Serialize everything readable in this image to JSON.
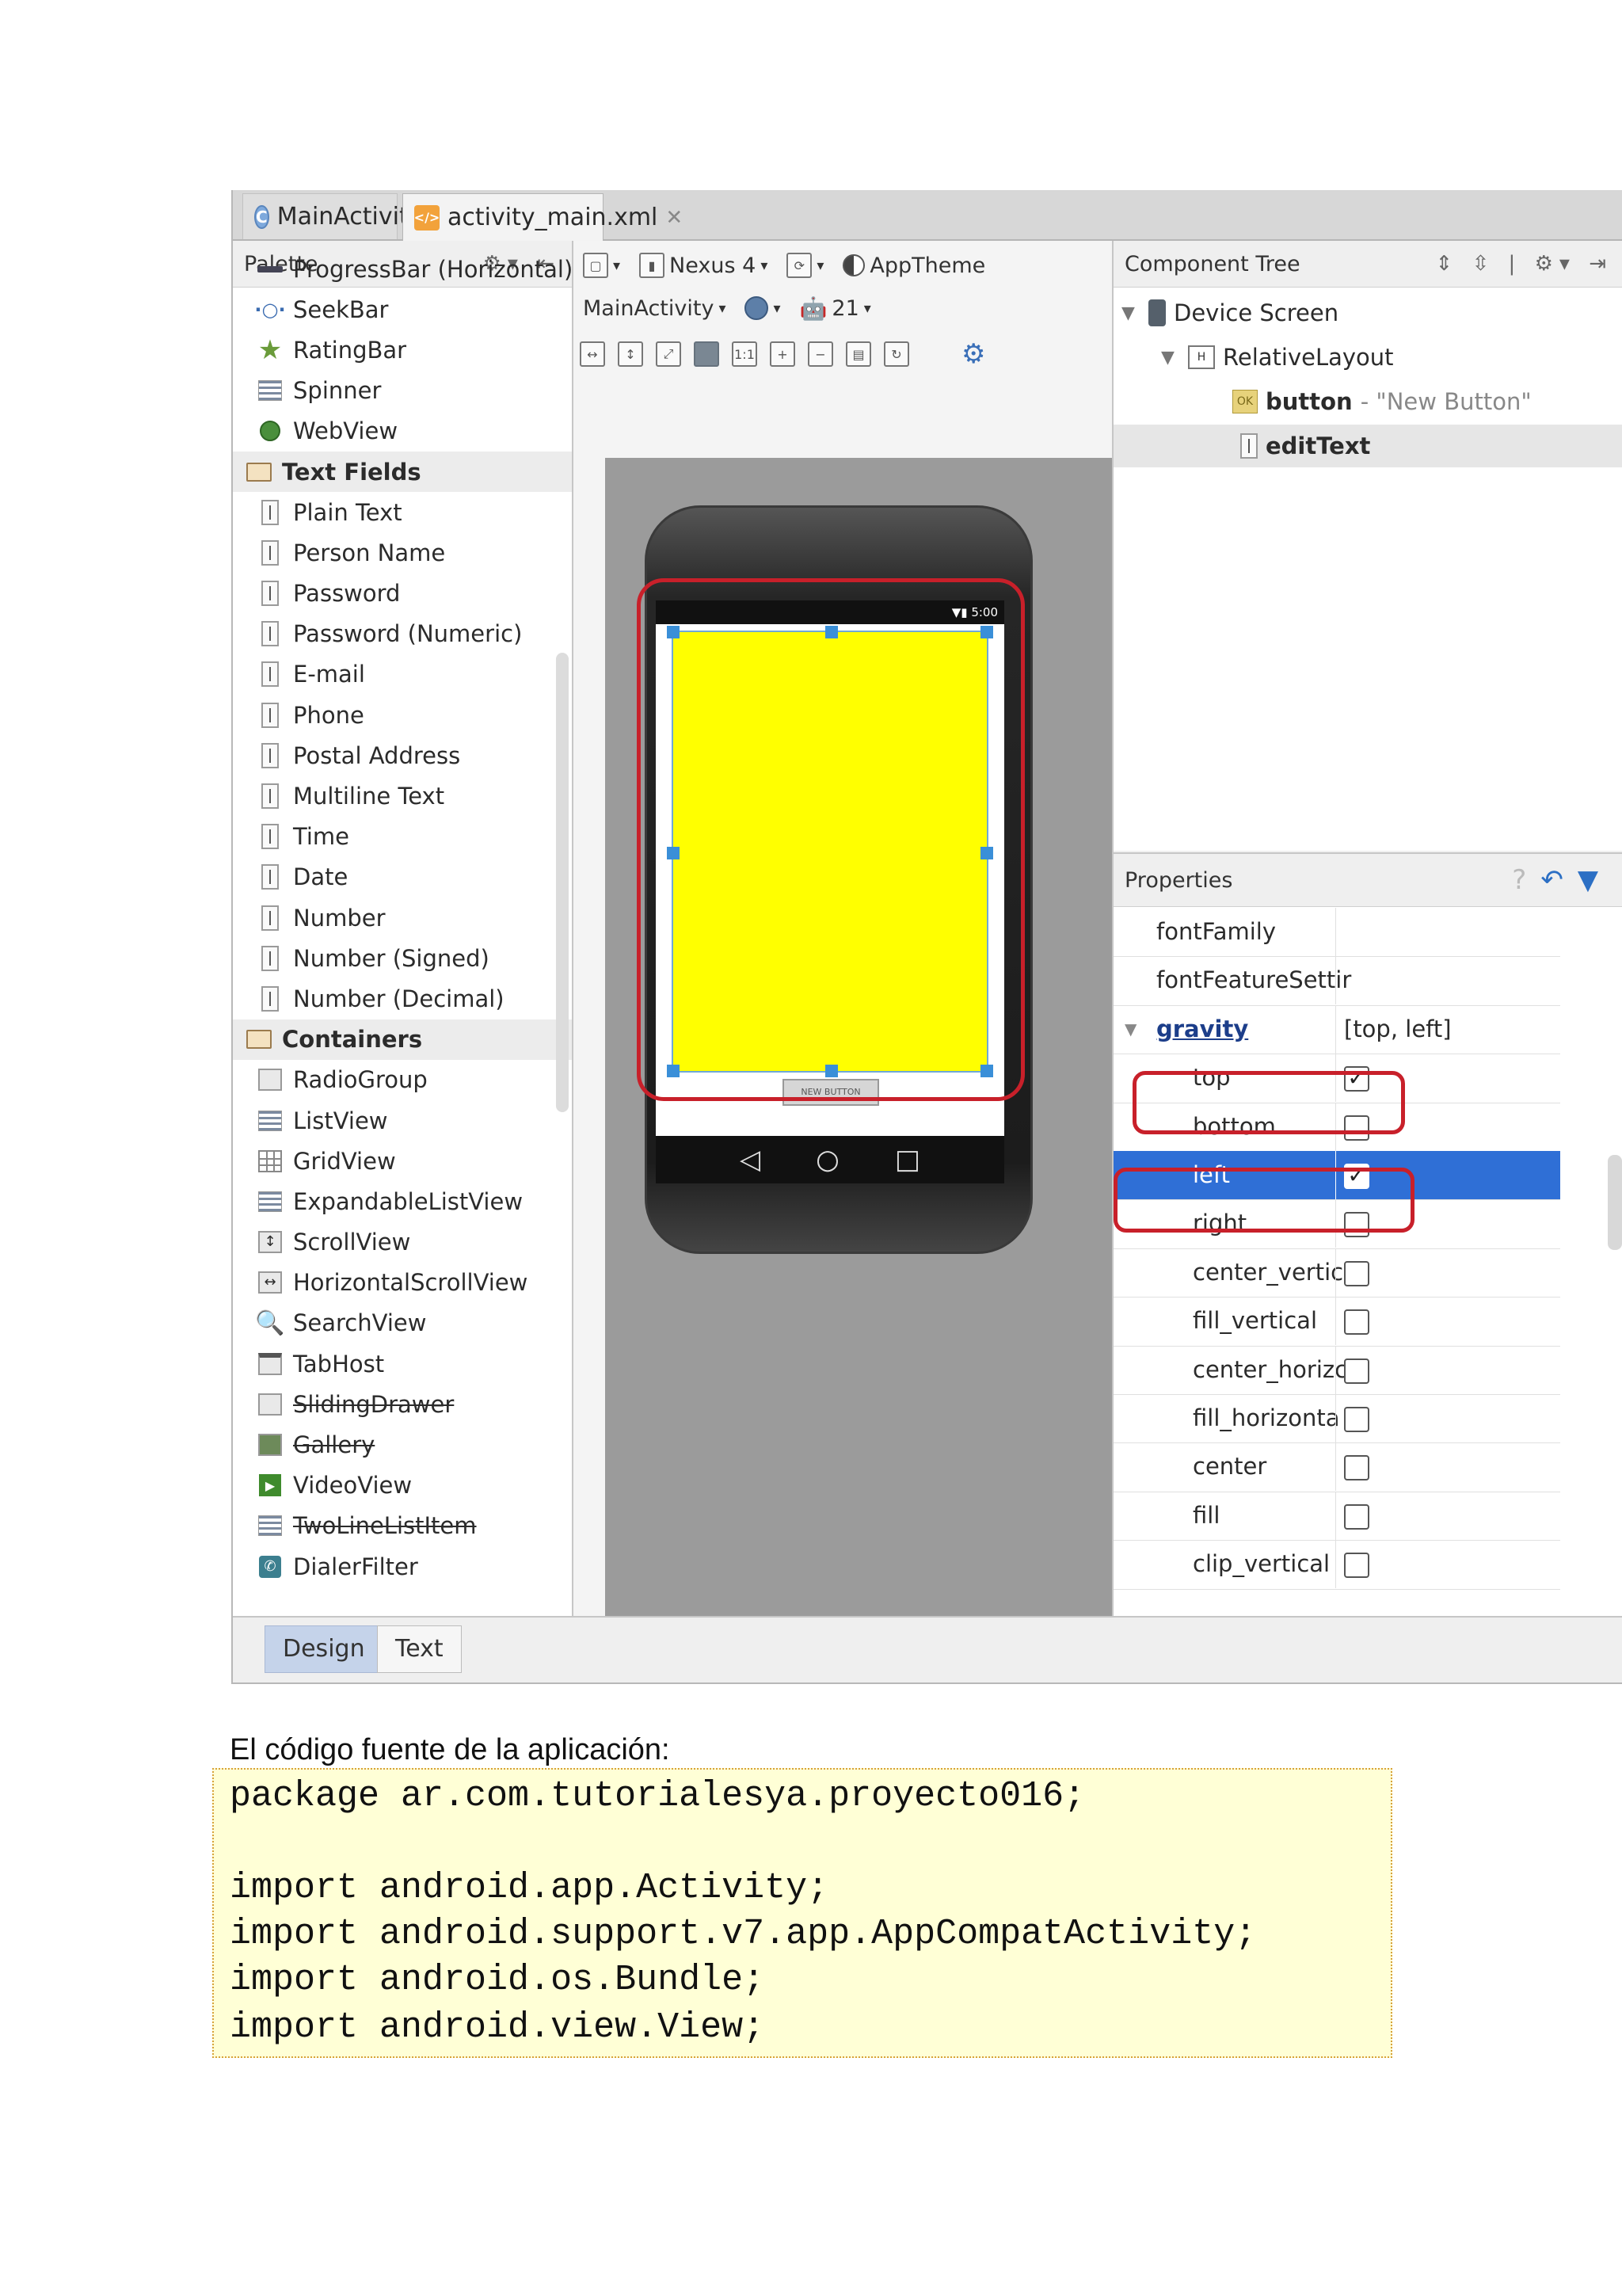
{
  "editor_tabs": [
    {
      "label": "MainActivity.java",
      "badge": "C"
    },
    {
      "label": "activity_main.xml",
      "badge": "xml"
    }
  ],
  "palette": {
    "title": "Palette",
    "items": [
      {
        "label": "ProgressBar (Horizontal)",
        "icon": "progressbar-icon"
      },
      {
        "label": "SeekBar",
        "icon": "seekbar-icon"
      },
      {
        "label": "RatingBar",
        "icon": "star-icon"
      },
      {
        "label": "Spinner",
        "icon": "spinner-icon"
      },
      {
        "label": "WebView",
        "icon": "webview-icon"
      },
      {
        "label": "Text Fields",
        "icon": "folder-icon",
        "category": true
      },
      {
        "label": "Plain Text",
        "icon": "textfield-icon"
      },
      {
        "label": "Person Name",
        "icon": "textfield-icon"
      },
      {
        "label": "Password",
        "icon": "textfield-icon"
      },
      {
        "label": "Password (Numeric)",
        "icon": "textfield-icon"
      },
      {
        "label": "E-mail",
        "icon": "textfield-icon"
      },
      {
        "label": "Phone",
        "icon": "textfield-icon"
      },
      {
        "label": "Postal Address",
        "icon": "textfield-icon"
      },
      {
        "label": "Multiline Text",
        "icon": "textfield-icon"
      },
      {
        "label": "Time",
        "icon": "textfield-icon"
      },
      {
        "label": "Date",
        "icon": "textfield-icon"
      },
      {
        "label": "Number",
        "icon": "textfield-icon"
      },
      {
        "label": "Number (Signed)",
        "icon": "textfield-icon"
      },
      {
        "label": "Number (Decimal)",
        "icon": "textfield-icon"
      },
      {
        "label": "Containers",
        "icon": "folder-icon",
        "category": true
      },
      {
        "label": "RadioGroup",
        "icon": "radiogroup-icon"
      },
      {
        "label": "ListView",
        "icon": "listview-icon"
      },
      {
        "label": "GridView",
        "icon": "gridview-icon"
      },
      {
        "label": "ExpandableListView",
        "icon": "expandable-list-icon"
      },
      {
        "label": "ScrollView",
        "icon": "scrollview-icon"
      },
      {
        "label": "HorizontalScrollView",
        "icon": "horizontal-scroll-icon"
      },
      {
        "label": "SearchView",
        "icon": "search-icon"
      },
      {
        "label": "TabHost",
        "icon": "tabhost-icon"
      },
      {
        "label": "SlidingDrawer",
        "icon": "sliding-drawer-icon",
        "deprecated": true
      },
      {
        "label": "Gallery",
        "icon": "gallery-icon",
        "deprecated": true
      },
      {
        "label": "VideoView",
        "icon": "video-icon"
      },
      {
        "label": "TwoLineListItem",
        "icon": "twoline-list-icon",
        "deprecated": true
      },
      {
        "label": "DialerFilter",
        "icon": "dialer-icon"
      }
    ]
  },
  "designer_toolbar": {
    "device": "Nexus 4",
    "theme": "AppTheme",
    "activity": "MainActivity",
    "api_level": "21"
  },
  "phone_preview": {
    "status_time": "5:00",
    "button_text": "NEW BUTTON",
    "edit_text_color": "#ffff00"
  },
  "component_tree": {
    "title": "Component Tree",
    "nodes": [
      {
        "label": "Device Screen"
      },
      {
        "label": "RelativeLayout"
      },
      {
        "label": "button",
        "suffix": " - \"New Button\""
      },
      {
        "label": "editText"
      }
    ]
  },
  "properties": {
    "title": "Properties",
    "rows": [
      {
        "name": "fontFamily",
        "value": ""
      },
      {
        "name": "fontFeatureSettir",
        "value": ""
      },
      {
        "name": "gravity",
        "value": "[top, left]"
      },
      {
        "name": "top",
        "checked": true
      },
      {
        "name": "bottom",
        "checked": false
      },
      {
        "name": "left",
        "checked": true,
        "selected": true
      },
      {
        "name": "right",
        "checked": false
      },
      {
        "name": "center_vertic:",
        "checked": false
      },
      {
        "name": "fill_vertical",
        "checked": false
      },
      {
        "name": "center_horizc",
        "checked": false
      },
      {
        "name": "fill_horizonta",
        "checked": false
      },
      {
        "name": "center",
        "checked": false
      },
      {
        "name": "fill",
        "checked": false
      },
      {
        "name": "clip_vertical",
        "checked": false
      }
    ]
  },
  "bottom_tabs": [
    "Design",
    "Text"
  ],
  "document": {
    "caption": "El código fuente de la aplicación:",
    "code_lines": [
      "package ar.com.tutorialesya.proyecto016;",
      "",
      "import android.app.Activity;",
      "import android.support.v7.app.AppCompatActivity;",
      "import android.os.Bundle;",
      "import android.view.View;"
    ]
  },
  "colors": {
    "highlight_red": "#c8202a",
    "selection_blue": "#2f6fd6",
    "code_background": "#ffffd6"
  }
}
